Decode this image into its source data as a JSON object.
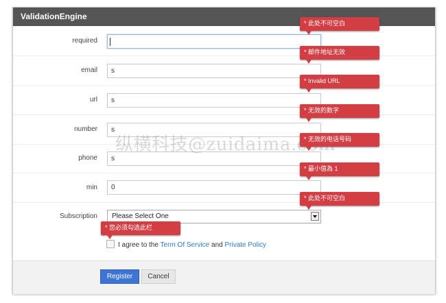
{
  "panel": {
    "title": "ValidationEngine"
  },
  "form": {
    "required": {
      "label": "required",
      "value": ""
    },
    "email": {
      "label": "email",
      "value": "s"
    },
    "url": {
      "label": "url",
      "value": "s"
    },
    "number": {
      "label": "number",
      "value": "s"
    },
    "phone": {
      "label": "phone",
      "value": "s"
    },
    "min": {
      "label": "min",
      "value": "0"
    },
    "subscription": {
      "label": "Subscription",
      "selected": "Please Select One"
    },
    "agree": {
      "prefix": "I agree to the",
      "term_link": "Term Of Service",
      "conjunction": "and",
      "privacy_link": "Private Policy"
    }
  },
  "errors": {
    "required": "* 此处不可空白",
    "email": "* 邮件地址无效",
    "url": "* Invalid URL",
    "number": "* 无效的数字",
    "phone": "* 无效的电话号码",
    "min": "* 最小值為 1",
    "subscription": "* 此处不可空白",
    "agree": "* 您必须勾选此栏"
  },
  "buttons": {
    "register": "Register",
    "cancel": "Cancel"
  },
  "watermark": "纵横科技@zuidaima.com",
  "colors": {
    "header_bg": "#555555",
    "error_bg": "#d33d44",
    "primary_button": "#3e74d4",
    "link": "#2f7bc8"
  }
}
